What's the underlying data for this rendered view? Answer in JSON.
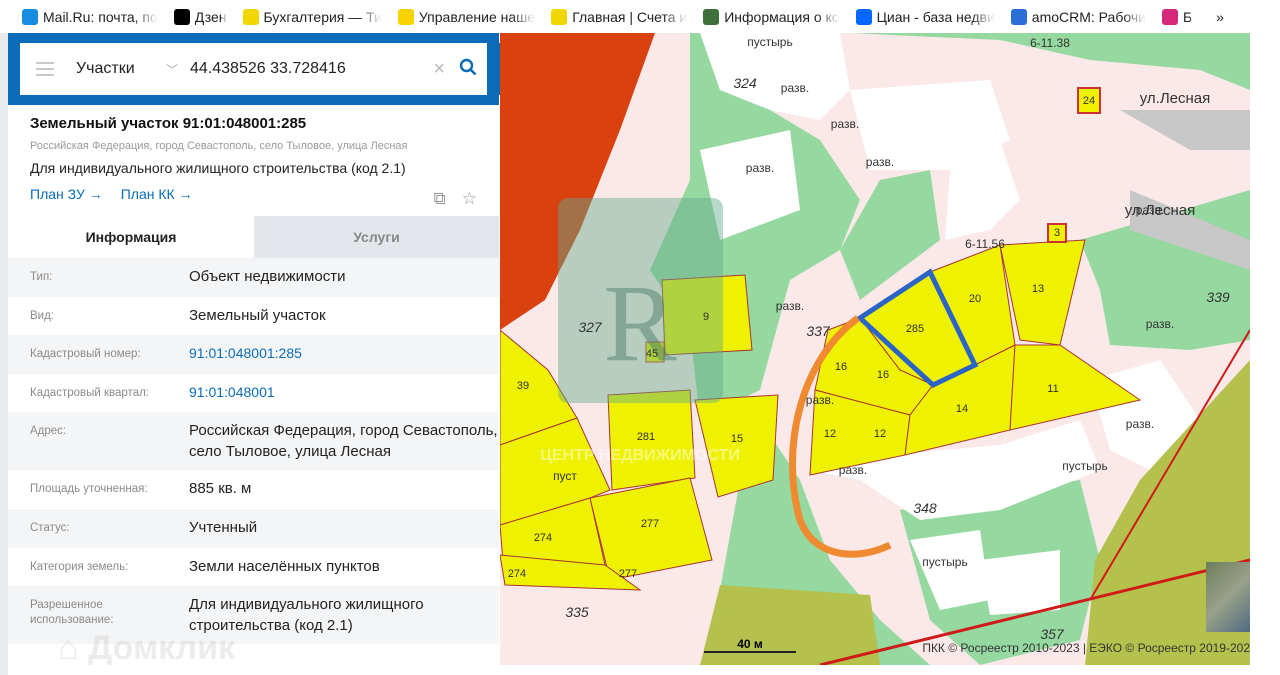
{
  "bookmarks": [
    {
      "label": "Mail.Ru: почта, по",
      "icon": "mailru-icon",
      "color": "#168de2"
    },
    {
      "label": "Дзен",
      "icon": "dzen-icon",
      "color": "#000000"
    },
    {
      "label": "Бухгалтерия — Ти",
      "icon": "tinkoff-icon",
      "color": "#f2d600"
    },
    {
      "label": "Управление наше",
      "icon": "1c-icon",
      "color": "#f9d300"
    },
    {
      "label": "Главная | Счета и",
      "icon": "tinkoff-icon",
      "color": "#f2d600"
    },
    {
      "label": "Информация о ко",
      "icon": "rk-icon",
      "color": "#3f6f3b"
    },
    {
      "label": "Циан - база недви",
      "icon": "cian-icon",
      "color": "#0468ff"
    },
    {
      "label": "amoCRM: Рабочи",
      "icon": "amocrm-icon",
      "color": "#2b6fd6"
    },
    {
      "label": "Б",
      "icon": "instagram-icon",
      "color": "#d6287a"
    }
  ],
  "bookmarks_more": "»",
  "search": {
    "category": "Участки",
    "query": "44.438526 33.728416"
  },
  "object": {
    "title": "Земельный участок 91:01:048001:285",
    "address": "Российская Федерация, город Севастополь, село Тыловое, улица Лесная",
    "use": "Для индивидуального жилищного строительства (код 2.1)",
    "link_plan_zu": "План ЗУ →",
    "link_plan_kk": "План КК →"
  },
  "tabs": [
    "Информация",
    "Услуги"
  ],
  "rows": [
    {
      "label": "Тип:",
      "value": "Объект недвижимости"
    },
    {
      "label": "Вид:",
      "value": "Земельный участок"
    },
    {
      "label": "Кадастровый номер:",
      "value": "91:01:048001:285",
      "link": true
    },
    {
      "label": "Кадастровый квартал:",
      "value": "91:01:048001",
      "link": true
    },
    {
      "label": "Адрес:",
      "value": "Российская Федерация, город Севастополь, село Тыловое, улица Лесная"
    },
    {
      "label": "Площадь уточненная:",
      "value": "885 кв. м"
    },
    {
      "label": "Статус:",
      "value": "Учтенный"
    },
    {
      "label": "Категория земель:",
      "value": "Земли населённых пунктов"
    },
    {
      "label": "Разрешенное использование:",
      "value": "Для индивидуального жилищного строительства (код 2.1)"
    }
  ],
  "watermarks": {
    "domclick": "Домклик",
    "center": "ЦЕНТР НЕДВИЖИМОСТИ"
  },
  "map": {
    "scale": "40 м",
    "attribution": "ПКК © Росреестр 2010-2023 | ЕЭКО © Росреестр 2019-202",
    "labels": [
      "пустырь",
      "разв.",
      "324",
      "разв.",
      "разв.",
      "разв.",
      "6-11.38",
      "ул.Лесная",
      "ул.Лесная",
      "24",
      "3",
      "разв.",
      "разв.",
      "6-11.56",
      "339",
      "разв.",
      "20",
      "13",
      "285",
      "9",
      "45",
      "327",
      "337",
      "16",
      "16",
      "разв.",
      "14",
      "11",
      "39",
      "281",
      "15",
      "12",
      "12",
      "разв.",
      "пустырь",
      "348",
      "274",
      "277",
      "274",
      "277",
      "335",
      "пустырь",
      "357",
      "разв.",
      "пуст"
    ]
  }
}
